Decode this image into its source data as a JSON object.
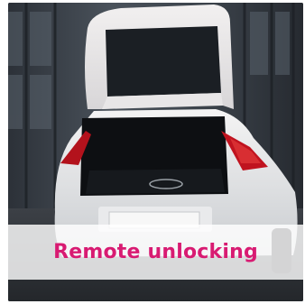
{
  "card": {
    "image": "car-open-trunk-photo",
    "caption": "Remote unlocking",
    "caption_color": "#d81b72"
  }
}
